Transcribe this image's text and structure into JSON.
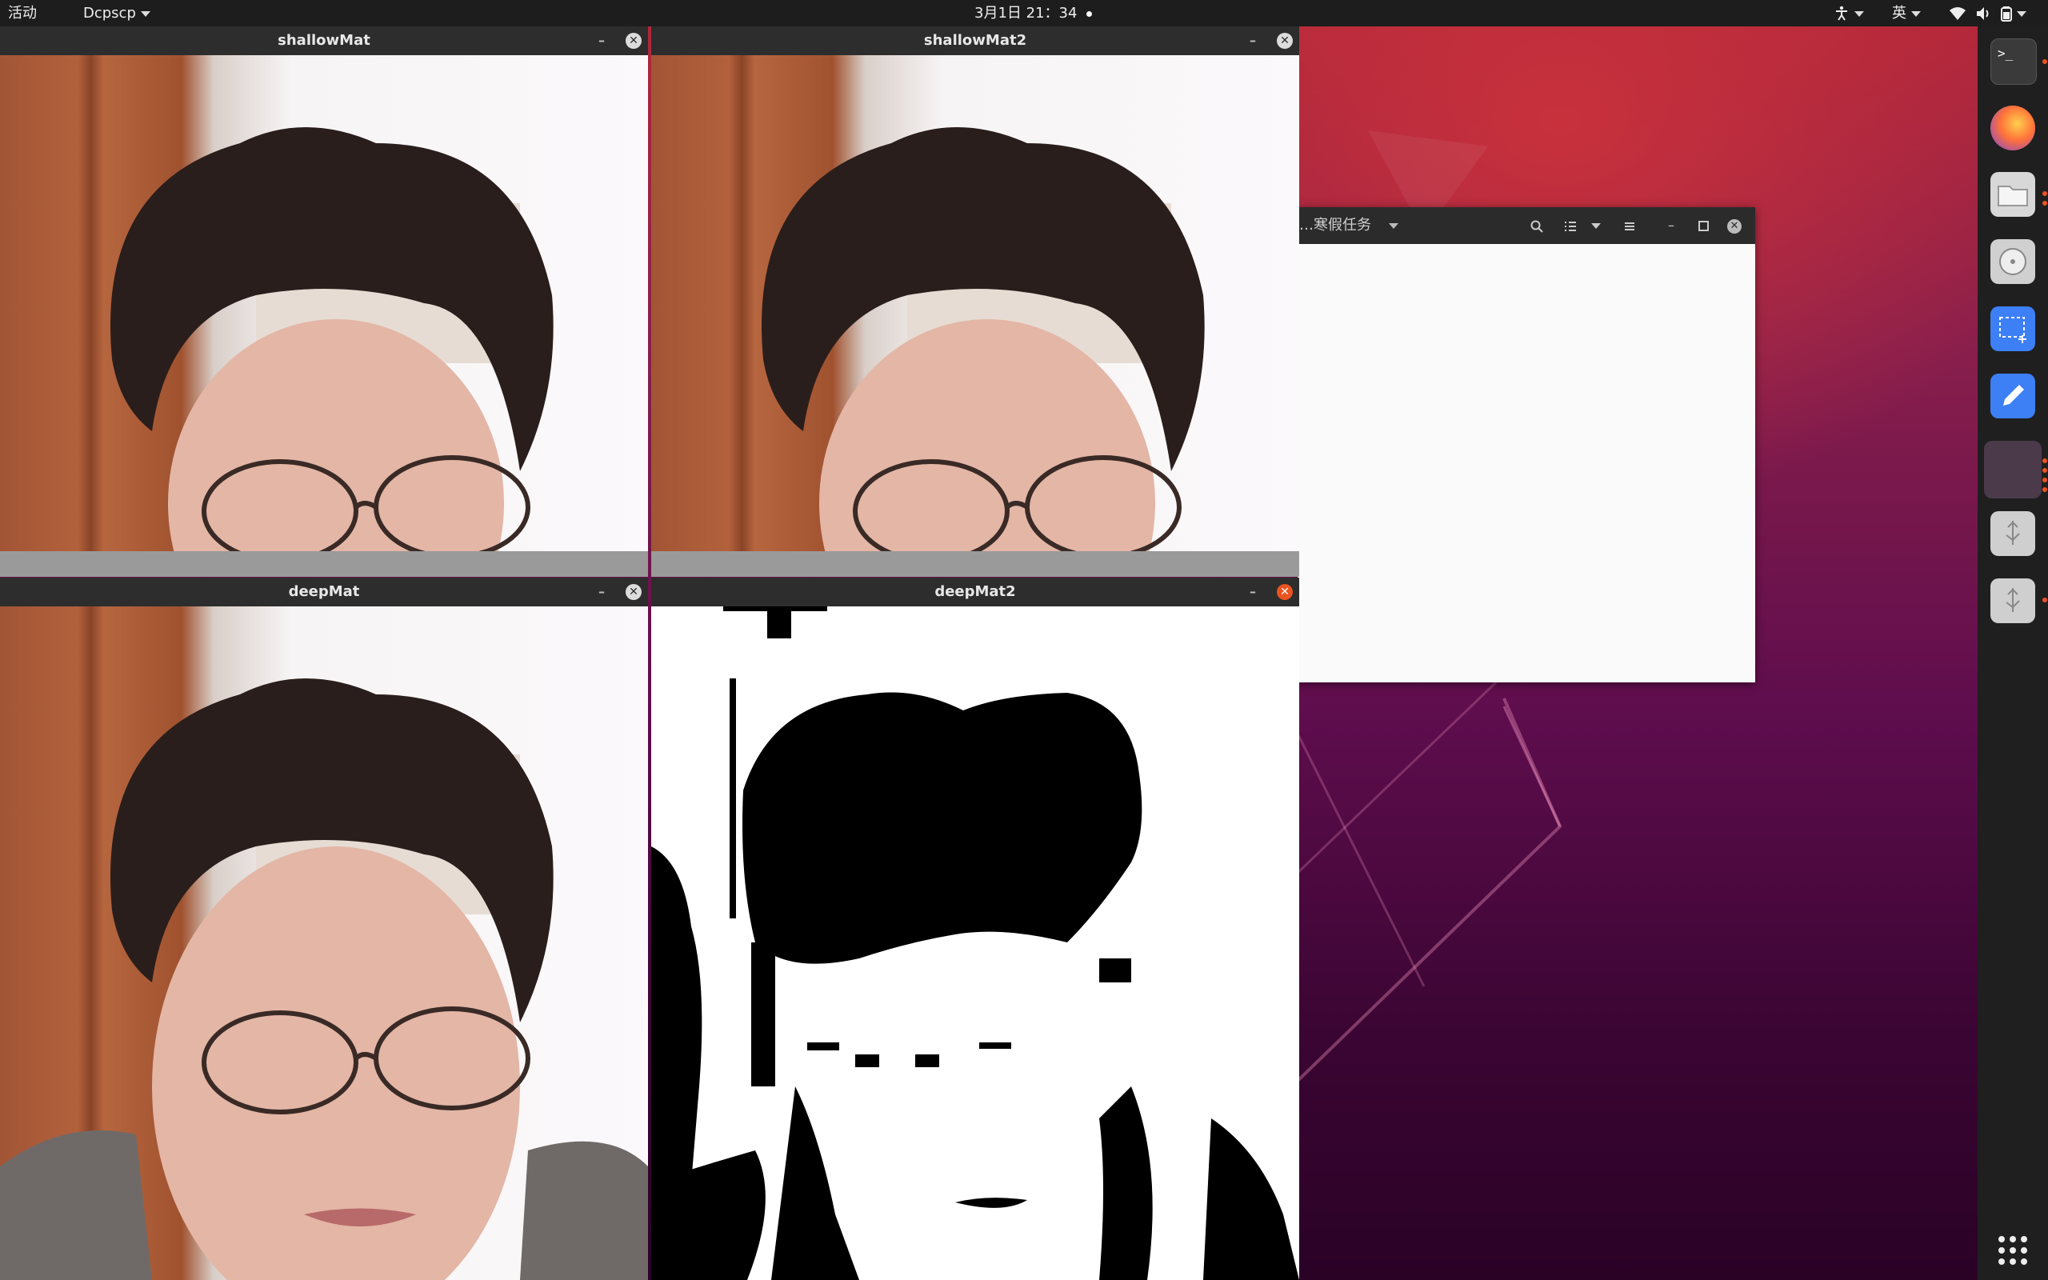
{
  "top_panel": {
    "activities": "活动",
    "app_menu": "Dcpscp",
    "datetime": "3月1日 21：34",
    "input_method": "英"
  },
  "windows": [
    {
      "title": "shallowMat"
    },
    {
      "title": "shallowMat2"
    },
    {
      "title": "deepMat"
    },
    {
      "title": "deepMat2"
    }
  ],
  "file_manager": {
    "path_label": "…寒假任务"
  },
  "dock": {
    "items": [
      "terminal-icon",
      "firefox-icon",
      "files-icon",
      "disk-icon",
      "screenshot-icon",
      "text-editor-icon",
      "running-app-icon",
      "usb-drive-icon",
      "usb-drive-icon",
      "show-apps-icon"
    ]
  },
  "colors": {
    "panel": "#1d1d1d",
    "accent": "#e95420",
    "title_bar": "#2d2d2d"
  }
}
